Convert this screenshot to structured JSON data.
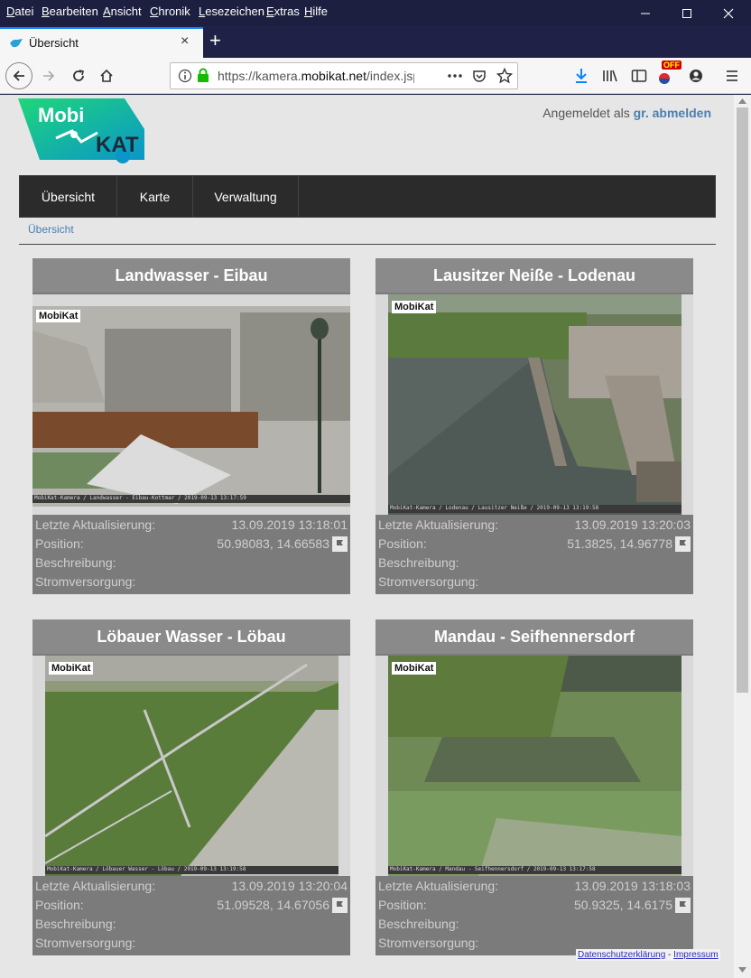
{
  "menubar": {
    "items": [
      "Datei",
      "Bearbeiten",
      "Ansicht",
      "Chronik",
      "Lesezeichen",
      "Extras",
      "Hilfe"
    ],
    "shortcuts": [
      "D",
      "B",
      "A",
      "C",
      "L",
      "E",
      "H"
    ]
  },
  "tab": {
    "title": "Übersicht",
    "close": "×"
  },
  "newtab": "+",
  "urlbar": {
    "prefix": "https://kamera.",
    "domain": "mobikat.net",
    "suffix": "/index.jsp"
  },
  "addon_badge": "OFF",
  "logo": {
    "word1": "Mobi",
    "word2": "KAT"
  },
  "login": {
    "text": "Angemeldet als ",
    "user": "gr.",
    "logout": "abmelden"
  },
  "nav": [
    "Übersicht",
    "Karte",
    "Verwaltung"
  ],
  "breadcrumb": "Übersicht",
  "labels": {
    "update": "Letzte Aktualisierung:",
    "position": "Position:",
    "description": "Beschreibung:",
    "power": "Stromversorgung:"
  },
  "cameras": [
    {
      "title": "Landwasser - Eibau",
      "updated": "13.09.2019 13:18:01",
      "position": "50.98083, 14.66583",
      "caption": "MobiKat-Kamera / Landwasser - Eibau-Kottmar / 2019-09-13 13:17:59"
    },
    {
      "title": "Lausitzer Neiße - Lodenau",
      "updated": "13.09.2019 13:20:03",
      "position": "51.3825, 14.96778",
      "caption": "MobiKat-Kamera / Lodenau / Lausitzer Neiße / 2019-09-13 13:19:58"
    },
    {
      "title": "Löbauer Wasser - Löbau",
      "updated": "13.09.2019 13:20:04",
      "position": "51.09528, 14.67056",
      "caption": "MobiKat-Kamera / Löbauer Wasser - Löbau / 2019-09-13 13:19:58"
    },
    {
      "title": "Mandau - Seifhennersdorf",
      "updated": "13.09.2019 13:18:03",
      "position": "50.9325, 14.6175",
      "caption": "MobiKat-Kamera / Mandau - Seifhennersdorf / 2019-09-13 13:17:58"
    }
  ],
  "watermark": "MobiKat",
  "footer": {
    "privacy": "Datenschutzerklärung",
    "sep": " - ",
    "imprint": "Impressum"
  },
  "colors": {
    "accent": "#0a84ff",
    "link": "#4a7fb0",
    "nav_bg": "#2b2b2b",
    "card_bg": "#7b7b7b"
  }
}
